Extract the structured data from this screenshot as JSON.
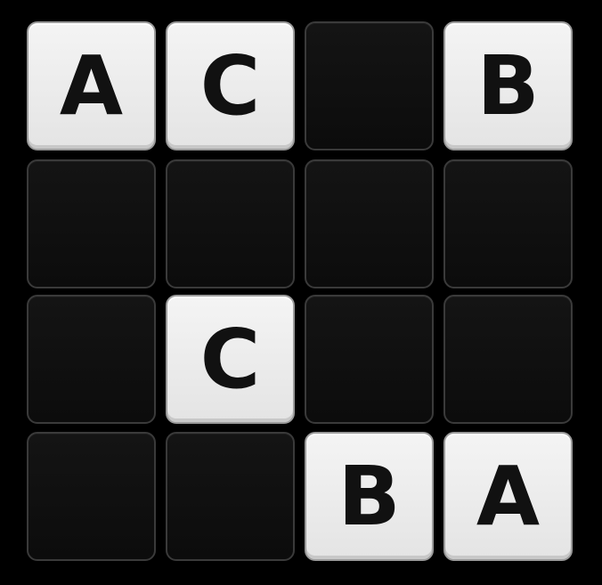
{
  "board": {
    "rows": 4,
    "cols": 4,
    "tiles": [
      {
        "letter": "A",
        "state": "revealed"
      },
      {
        "letter": "C",
        "state": "revealed"
      },
      {
        "letter": "",
        "state": "hidden"
      },
      {
        "letter": "B",
        "state": "revealed"
      },
      {
        "letter": "",
        "state": "hidden"
      },
      {
        "letter": "",
        "state": "hidden"
      },
      {
        "letter": "",
        "state": "hidden"
      },
      {
        "letter": "",
        "state": "hidden"
      },
      {
        "letter": "",
        "state": "hidden"
      },
      {
        "letter": "C",
        "state": "revealed"
      },
      {
        "letter": "",
        "state": "hidden"
      },
      {
        "letter": "",
        "state": "hidden"
      },
      {
        "letter": "",
        "state": "hidden"
      },
      {
        "letter": "",
        "state": "hidden"
      },
      {
        "letter": "B",
        "state": "revealed"
      },
      {
        "letter": "A",
        "state": "revealed"
      }
    ]
  },
  "colors": {
    "background": "#000000",
    "revealed_tile": "#ececec",
    "hidden_tile": "#111111",
    "letter": "#111111"
  }
}
